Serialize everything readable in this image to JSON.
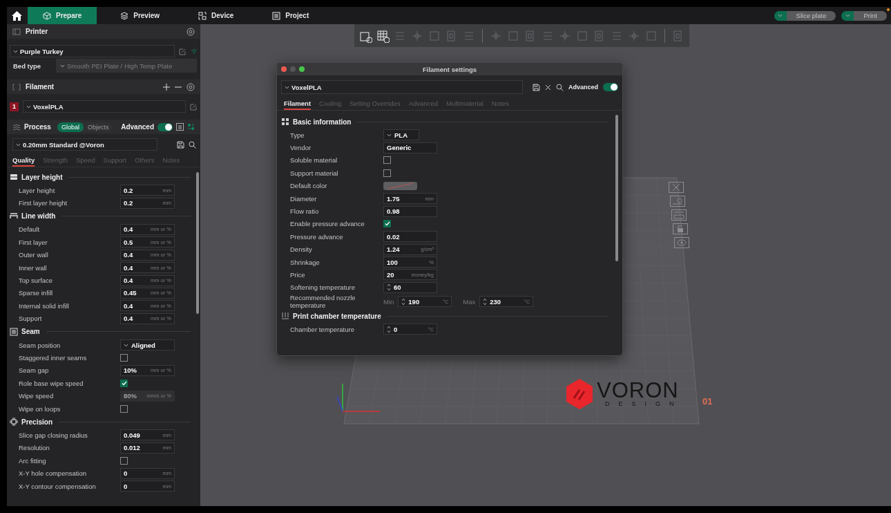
{
  "topbar": {
    "tabs": [
      {
        "label": "Prepare",
        "selected": true
      },
      {
        "label": "Preview",
        "selected": false
      },
      {
        "label": "Device",
        "selected": false
      },
      {
        "label": "Project",
        "selected": false
      }
    ],
    "actions": [
      {
        "label": "Slice plate",
        "disabled": true
      },
      {
        "label": "Print",
        "disabled": true
      }
    ]
  },
  "sidebar": {
    "printer": {
      "title": "Printer",
      "preset": "Purple Turkey",
      "bed_type": {
        "label": "Bed type",
        "value": "Smooth PEI Plate / High Temp Plate",
        "disabled": true
      }
    },
    "filament": {
      "title": "Filament",
      "items": [
        {
          "index": "1",
          "name": "VoxelPLA",
          "color": "#8c1522"
        }
      ]
    },
    "process": {
      "title": "Process",
      "scopes": [
        {
          "label": "Global",
          "selected": true
        },
        {
          "label": "Objects",
          "selected": false
        }
      ],
      "advanced": {
        "label": "Advanced",
        "on": true
      },
      "preset": "0.20mm Standard @Voron",
      "tabs": [
        {
          "label": "Quality",
          "selected": true
        },
        {
          "label": "Strength",
          "selected": false
        },
        {
          "label": "Speed",
          "selected": false
        },
        {
          "label": "Support",
          "selected": false
        },
        {
          "label": "Others",
          "selected": false
        },
        {
          "label": "Notes",
          "selected": false
        }
      ]
    },
    "groups": [
      {
        "title": "Layer height",
        "rows": [
          {
            "kind": "number",
            "label": "Layer height",
            "value": "0.2",
            "unit": "mm",
            "disabled": false
          },
          {
            "kind": "number",
            "label": "First layer height",
            "value": "0.2",
            "unit": "mm",
            "disabled": false
          }
        ]
      },
      {
        "title": "Line width",
        "rows": [
          {
            "kind": "number",
            "label": "Default",
            "value": "0.4",
            "unit": "mm or %",
            "disabled": false
          },
          {
            "kind": "number",
            "label": "First layer",
            "value": "0.5",
            "unit": "mm or %",
            "disabled": false
          },
          {
            "kind": "number",
            "label": "Outer wall",
            "value": "0.4",
            "unit": "mm or %",
            "disabled": false
          },
          {
            "kind": "number",
            "label": "Inner wall",
            "value": "0.4",
            "unit": "mm or %",
            "disabled": false
          },
          {
            "kind": "number",
            "label": "Top surface",
            "value": "0.4",
            "unit": "mm or %",
            "disabled": false
          },
          {
            "kind": "number",
            "label": "Sparse infill",
            "value": "0.45",
            "unit": "mm or %",
            "disabled": false
          },
          {
            "kind": "number",
            "label": "Internal solid infill",
            "value": "0.4",
            "unit": "mm or %",
            "disabled": false
          },
          {
            "kind": "number",
            "label": "Support",
            "value": "0.4",
            "unit": "mm or %",
            "disabled": false
          }
        ]
      },
      {
        "title": "Seam",
        "rows": [
          {
            "kind": "dropdown",
            "label": "Seam position",
            "value": "Aligned",
            "disabled": false
          },
          {
            "kind": "checkbox",
            "label": "Staggered inner seams",
            "checked": false,
            "disabled": false
          },
          {
            "kind": "number",
            "label": "Seam gap",
            "value": "10%",
            "unit": "mm or %",
            "disabled": false
          },
          {
            "kind": "checkbox",
            "label": "Role base wipe speed",
            "checked": true,
            "disabled": false
          },
          {
            "kind": "number",
            "label": "Wipe speed",
            "value": "80%",
            "unit": "mm/s or %",
            "disabled": true
          },
          {
            "kind": "checkbox",
            "label": "Wipe on loops",
            "checked": false,
            "disabled": false
          }
        ]
      },
      {
        "title": "Precision",
        "rows": [
          {
            "kind": "number",
            "label": "Slice gap closing radius",
            "value": "0.049",
            "unit": "mm",
            "disabled": false
          },
          {
            "kind": "number",
            "label": "Resolution",
            "value": "0.012",
            "unit": "mm",
            "disabled": false
          },
          {
            "kind": "checkbox",
            "label": "Arc fitting",
            "checked": false,
            "disabled": false
          },
          {
            "kind": "number",
            "label": "X-Y hole compensation",
            "value": "0",
            "unit": "mm",
            "disabled": false
          },
          {
            "kind": "number",
            "label": "X-Y contour compensation",
            "value": "0",
            "unit": "mm",
            "disabled": false
          }
        ]
      }
    ]
  },
  "viewport": {
    "toolbar": [
      {
        "disabled": false
      },
      {
        "disabled": false
      },
      {
        "disabled": true
      },
      {
        "disabled": true
      },
      {
        "disabled": true
      },
      {
        "disabled": true
      },
      {
        "disabled": true
      },
      {
        "disabled": true
      },
      {
        "disabled": true
      },
      {
        "disabled": true
      },
      {
        "disabled": true
      },
      {
        "disabled": true
      },
      {
        "disabled": true
      },
      {
        "disabled": true
      },
      {
        "disabled": true
      },
      {
        "disabled": true
      },
      {
        "disabled": true
      },
      {
        "disabled": true
      }
    ],
    "plate_logo": {
      "name": "VORON",
      "subtitle": "DESIGN"
    },
    "plate_number": "01"
  },
  "dialog": {
    "title": "Filament settings",
    "preset": "VoxelPLA",
    "advanced": {
      "label": "Advanced",
      "on": true
    },
    "tabs": [
      {
        "label": "Filament",
        "selected": true
      },
      {
        "label": "Cooling",
        "selected": false
      },
      {
        "label": "Setting Overrides",
        "selected": false
      },
      {
        "label": "Advanced",
        "selected": false
      },
      {
        "label": "Multimaterial",
        "selected": false
      },
      {
        "label": "Notes",
        "selected": false
      }
    ],
    "groups": [
      {
        "title": "Basic information",
        "rows": [
          {
            "kind": "dropdown",
            "label": "Type",
            "value": "PLA"
          },
          {
            "kind": "text",
            "label": "Vendor",
            "value": "Generic"
          },
          {
            "kind": "checkbox",
            "label": "Soluble material",
            "checked": false
          },
          {
            "kind": "checkbox",
            "label": "Support material",
            "checked": false
          },
          {
            "kind": "color",
            "label": "Default color"
          },
          {
            "kind": "number",
            "label": "Diameter",
            "value": "1.75",
            "unit": "mm"
          },
          {
            "kind": "number",
            "label": "Flow ratio",
            "value": "0.98"
          },
          {
            "kind": "checkbox",
            "label": "Enable pressure advance",
            "checked": true
          },
          {
            "kind": "number",
            "label": "Pressure advance",
            "value": "0.02"
          },
          {
            "kind": "number",
            "label": "Density",
            "value": "1.24",
            "unit": "g/cm³"
          },
          {
            "kind": "number",
            "label": "Shrinkage",
            "value": "100",
            "unit": "%"
          },
          {
            "kind": "number",
            "label": "Price",
            "value": "20",
            "unit": "money/kg"
          },
          {
            "kind": "spin",
            "label": "Softening temperature",
            "value": "60"
          },
          {
            "kind": "range",
            "label": "Recommended nozzle temperature",
            "min_label": "Min",
            "min": "190",
            "min_unit": "°C",
            "max_label": "Max",
            "max": "230",
            "max_unit": "°C"
          }
        ]
      },
      {
        "title": "Print chamber temperature",
        "rows": [
          {
            "kind": "spin",
            "label": "Chamber temperature",
            "value": "0",
            "unit": "°C"
          }
        ]
      }
    ]
  }
}
